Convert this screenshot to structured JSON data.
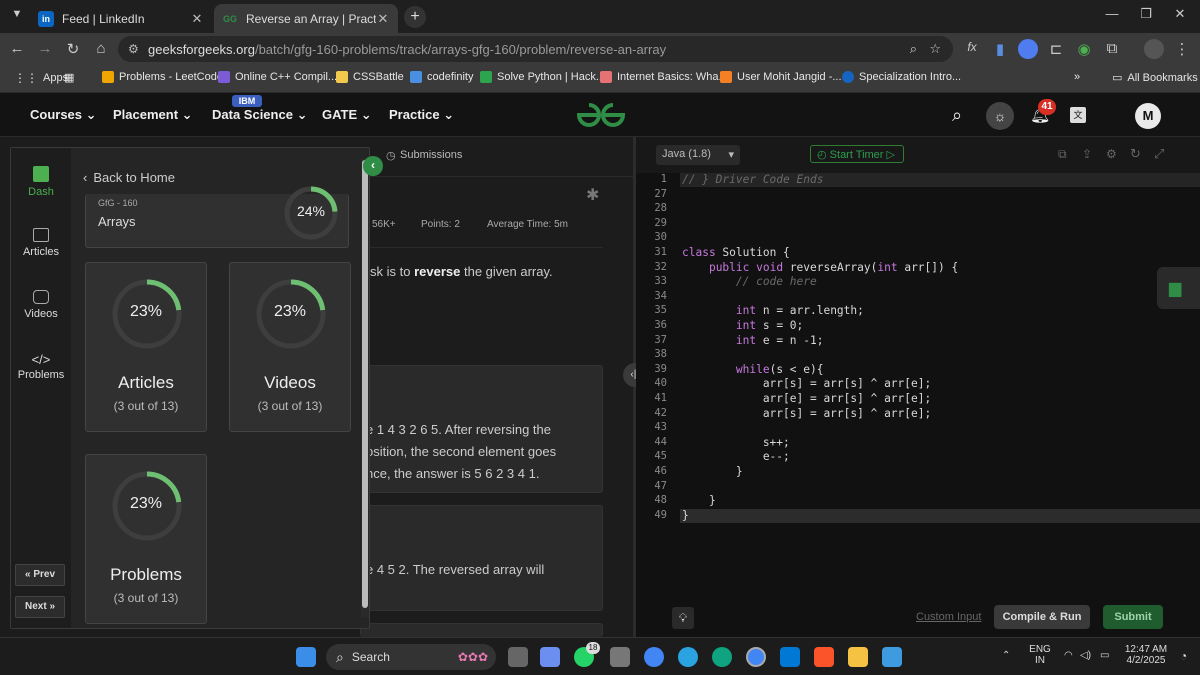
{
  "browser": {
    "tabs": [
      {
        "title": "Feed | LinkedIn",
        "favicon": "in",
        "color": "#0a66c2"
      },
      {
        "title": "Reverse an Array | Practice | Ge",
        "favicon": "GG",
        "color": "#2f8d46"
      }
    ],
    "new_tab": "+",
    "url_site": "geeksforgeeks.org",
    "url_path": "/batch/gfg-160-problems/track/arrays-gfg-160/problem/reverse-an-array"
  },
  "bookmarks": [
    {
      "label": "Apps",
      "color": "#555"
    },
    {
      "label": "Problems - LeetCode",
      "color": "#f0a500"
    },
    {
      "label": "Online C++ Compil...",
      "color": "#7b5cd6"
    },
    {
      "label": "CSSBattle",
      "color": "#f2c94c"
    },
    {
      "label": "codefinity",
      "color": "#4a90e2"
    },
    {
      "label": "Solve Python | Hack...",
      "color": "#2ea44f"
    },
    {
      "label": "Internet Basics: Wha...",
      "color": "#e57373"
    },
    {
      "label": "User Mohit Jangid -...",
      "color": "#f48024"
    },
    {
      "label": "Specialization Intro...",
      "color": "#1565c0"
    }
  ],
  "all_bookmarks": "All Bookmarks",
  "gfg_nav": {
    "items": [
      "Courses",
      "Placement",
      "Data Science",
      "GATE",
      "Practice"
    ],
    "ibm_badge": "IBM",
    "notification_count": "41",
    "avatar_letter": "M"
  },
  "problem": {
    "submissions_tab": "Submissions",
    "stats_count": "56K+",
    "points": "Points: 2",
    "avg_time_label": "Average Time: 5m",
    "task_prefix": "sk is to ",
    "task_bold": "reverse",
    "task_suffix": " the given array.",
    "ex1_line1": "e 1 4 3 2 6 5. After reversing the",
    "ex1_line2": "osition, the second element goes",
    "ex1_line3": "nce, the answer is 5 6 2 3 4 1.",
    "ex2_line1": "e 4 5 2. The reversed array will"
  },
  "panel": {
    "rail": [
      {
        "label": "Dash",
        "icon": "dashboard-icon"
      },
      {
        "label": "Articles",
        "icon": "book-icon"
      },
      {
        "label": "Videos",
        "icon": "video-icon"
      },
      {
        "label": "Problems",
        "icon": "code-icon"
      }
    ],
    "back_label": "Back to Home",
    "track_small": "GfG - 160",
    "track_name": "Arrays",
    "track_pct": "24%",
    "prev_label": "Prev",
    "next_label": "Next",
    "stats": [
      {
        "label": "Articles",
        "pct": "23%",
        "sub": "(3 out of 13)",
        "value": 0.23
      },
      {
        "label": "Videos",
        "pct": "23%",
        "sub": "(3 out of 13)",
        "value": 0.23
      },
      {
        "label": "Problems",
        "pct": "23%",
        "sub": "(3 out of 13)",
        "value": 0.23
      }
    ],
    "track_value": 0.24
  },
  "editor": {
    "language": "Java (1.8)",
    "timer_label": "Start Timer",
    "line_numbers": [
      "1",
      "27",
      "28",
      "29",
      "30",
      "31",
      "32",
      "33",
      "34",
      "35",
      "36",
      "37",
      "38",
      "39",
      "40",
      "41",
      "42",
      "43",
      "44",
      "45",
      "46",
      "47",
      "48",
      "49"
    ],
    "lines": [
      "// } Driver Code Ends",
      "",
      "",
      "",
      "",
      "class Solution {",
      "    public void reverseArray(int arr[]) {",
      "        // code here",
      "",
      "        int n = arr.length;",
      "        int s = 0;",
      "        int e = n -1;",
      "",
      "        while(s < e){",
      "            arr[s] = arr[s] ^ arr[e];",
      "            arr[e] = arr[s] ^ arr[e];",
      "            arr[s] = arr[s] ^ arr[e];",
      "",
      "            s++;",
      "            e--;",
      "        }",
      "",
      "    }",
      "}"
    ],
    "custom_input": "Custom Input",
    "compile_run": "Compile & Run",
    "submit": "Submit"
  },
  "taskbar": {
    "search": "Search",
    "lang1": "ENG",
    "lang2": "IN",
    "time": "12:47 AM",
    "date": "4/2/2025",
    "whatsapp_badge": "18"
  },
  "colors": {
    "accent": "#2f8d46",
    "ring_track": "#3e3e3e",
    "ring_fill": "#6fbf73"
  }
}
